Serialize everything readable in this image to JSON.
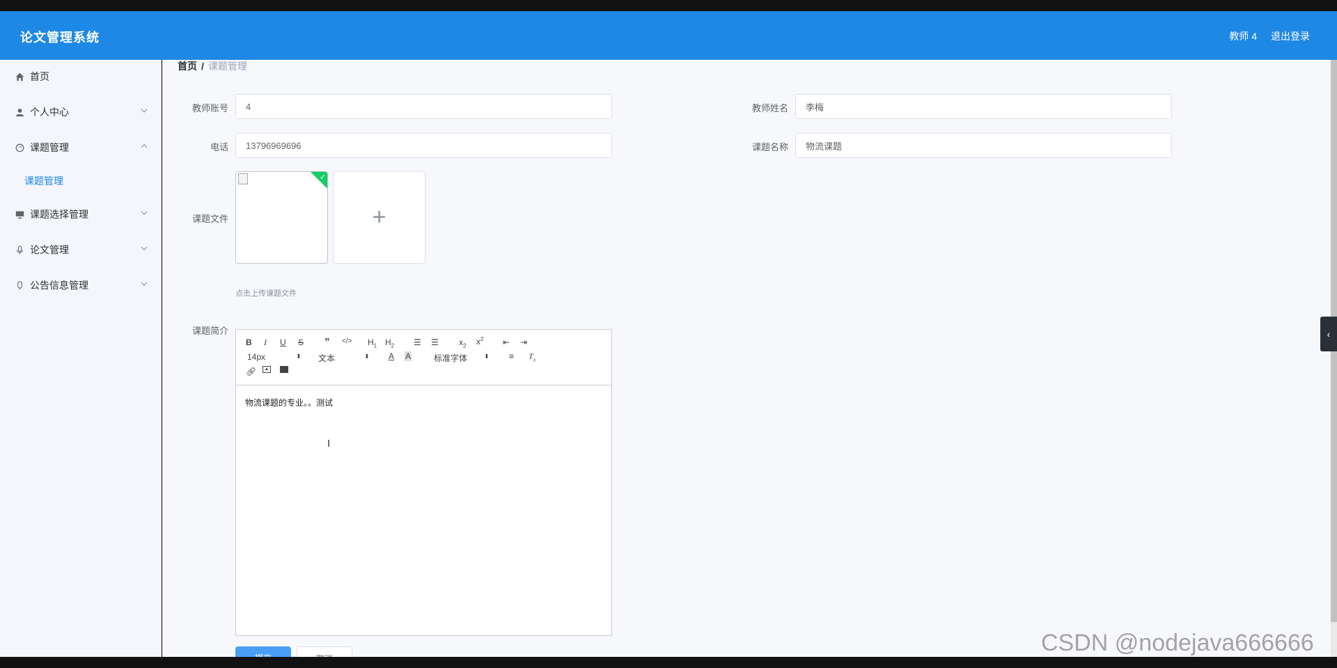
{
  "app": {
    "title": "论文管理系统"
  },
  "header": {
    "user": "教师 4",
    "logout": "退出登录"
  },
  "sidebar": {
    "items": [
      {
        "label": "首页",
        "icon": "home-icon"
      },
      {
        "label": "个人中心",
        "icon": "user-icon"
      },
      {
        "label": "课题管理",
        "icon": "dashboard-icon"
      },
      {
        "label": "课题选择管理",
        "icon": "monitor-icon"
      },
      {
        "label": "论文管理",
        "icon": "microphone-icon"
      },
      {
        "label": "公告信息管理",
        "icon": "bell-icon"
      }
    ],
    "subitem": "课题管理"
  },
  "breadcrumb": {
    "home": "首页",
    "separator": "/",
    "current": "课题管理"
  },
  "form": {
    "teacher_account": {
      "label": "教师账号",
      "value": "4"
    },
    "teacher_name": {
      "label": "教师姓名",
      "value": "李梅"
    },
    "phone": {
      "label": "电话",
      "value": "13796969696"
    },
    "topic_name": {
      "label": "课题名称",
      "value": "物流课题"
    },
    "topic_file": {
      "label": "课题文件",
      "tip": "点击上传课题文件"
    },
    "topic_intro": {
      "label": "课题简介",
      "content": "物流课题的专业。。测试"
    }
  },
  "editor": {
    "font_size": "14px",
    "block_type": "文本",
    "font_family": "标准字体"
  },
  "buttons": {
    "submit": "提交",
    "cancel": "取消"
  },
  "watermark": "CSDN @nodejava666666",
  "colors": {
    "header": "#1e88e5",
    "accent": "#1e88e5",
    "success": "#13ce66"
  }
}
